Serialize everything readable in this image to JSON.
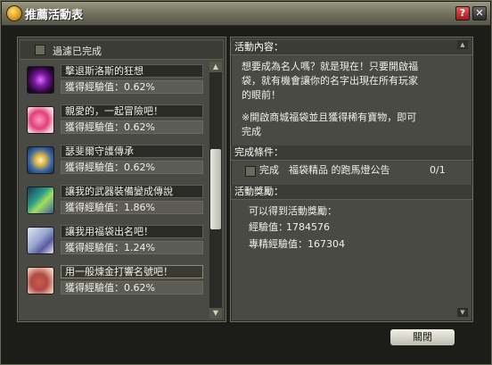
{
  "window": {
    "title": "推薦活動表",
    "help_label": "?",
    "close_label": "✕"
  },
  "left": {
    "header_label": "過濾已完成",
    "quests": [
      {
        "name": "擊退斯洛斯的狂想",
        "exp": "獲得經驗值：0.62%",
        "icon": "dark-orb-icon"
      },
      {
        "name": "親愛的，一起冒險吧！",
        "exp": "獲得經驗值：0.62%",
        "icon": "hearts-icon"
      },
      {
        "name": "瑟斐爾守護傳承",
        "exp": "獲得經驗值：0.62%",
        "icon": "crest-icon"
      },
      {
        "name": "讓我的武器裝備變成傳說",
        "exp": "獲得經驗值：1.86%",
        "icon": "weapon-icon"
      },
      {
        "name": "讓我用福袋出名吧！",
        "exp": "獲得經驗值：1.24%",
        "icon": "lucky-bag-icon"
      },
      {
        "name": "用一般煉金打響名號吧！",
        "exp": "獲得經驗值：0.62%",
        "icon": "alchemy-icon"
      }
    ],
    "scroll_up": "▲",
    "scroll_down": "▼"
  },
  "right": {
    "content_title": "活動內容：",
    "content_lines": [
      "想要成為名人嗎？就是現在！只要開啟福",
      "袋，就有機會讓你的名字出現在所有玩家",
      "的眼前！"
    ],
    "note_lines": [
      "※開啟商城福袋並且獲得稀有寶物，即可",
      "完成"
    ],
    "condition_title": "完成條件：",
    "condition_status": "完成",
    "condition_text": "福袋精品 的跑馬燈公告",
    "condition_count": "0/1",
    "reward_title": "活動獎勵：",
    "reward_intro": "可以得到活動獎勵：",
    "reward_exp_label": "經驗值：",
    "reward_exp_value": "1784576",
    "reward_prof_label": "專精經驗值：",
    "reward_prof_value": "167304"
  },
  "buttons": {
    "close_label": "關閉"
  }
}
